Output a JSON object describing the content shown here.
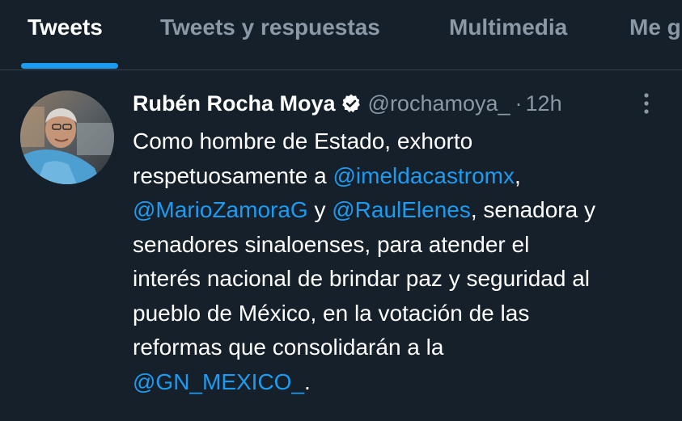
{
  "tabs": [
    {
      "label": "Tweets",
      "active": true
    },
    {
      "label": "Tweets y respuestas",
      "active": false
    },
    {
      "label": "Multimedia",
      "active": false
    },
    {
      "label": "Me g",
      "active": false
    }
  ],
  "tweet": {
    "display_name": "Rubén Rocha Moya",
    "verified": true,
    "handle": "@rochamoya_",
    "separator": "·",
    "time": "12h",
    "text": {
      "l1": "Como hombre de Estado, exhorto",
      "l2_pre": "respetuosamente a ",
      "mention_1": "@imeldacastromx",
      "l2_post": ",",
      "mention_2": "@MarioZamoraG",
      "l3_mid": " y ",
      "mention_3": "@RaulElenes",
      "l3_post": ", senadora y",
      "l4": "senadores sinaloenses, para atender el",
      "l5": "interés nacional de brindar paz y seguridad al",
      "l6": "pueblo de México, en la votación de las",
      "l7": "reformas que consolidarán a la",
      "mention_4": "@GN_MEXICO_",
      "l8_post": "."
    }
  },
  "icons": {
    "verified": "verified-badge-icon",
    "more": "more-options-icon"
  },
  "colors": {
    "background": "#15202b",
    "accent": "#1d9bf0",
    "secondary_text": "#8b98a5",
    "divider": "#38444d"
  }
}
